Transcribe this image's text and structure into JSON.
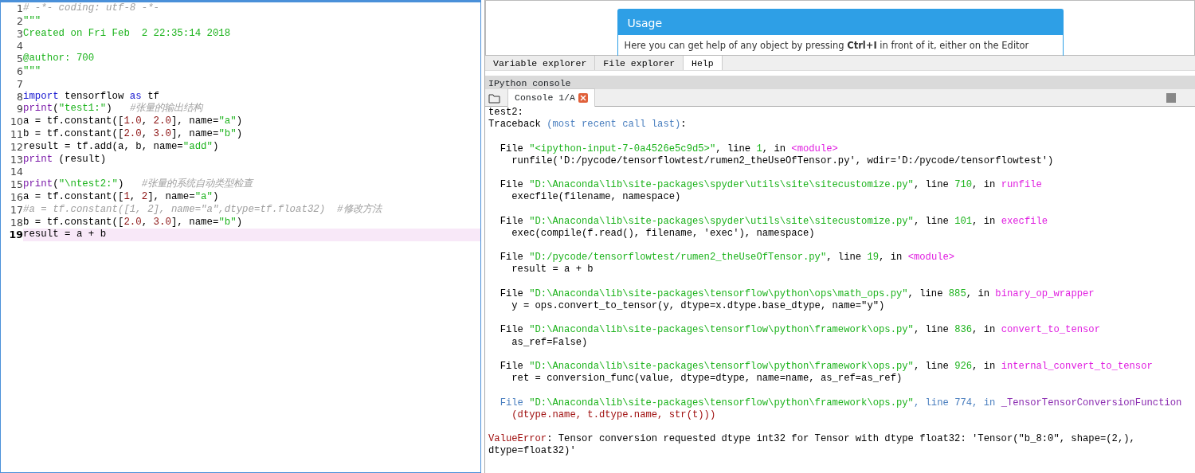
{
  "editor": {
    "lines": [
      {
        "number": "1",
        "current": false,
        "segments": [
          {
            "kind": "comment",
            "text": "# -*- coding: utf-8 -*-"
          }
        ]
      },
      {
        "number": "2",
        "current": false,
        "segments": [
          {
            "kind": "docstring",
            "text": "\"\"\""
          }
        ]
      },
      {
        "number": "3",
        "current": false,
        "segments": [
          {
            "kind": "docstring",
            "text": "Created on Fri Feb  2 22:35:14 2018"
          }
        ]
      },
      {
        "number": "4",
        "current": false
      },
      {
        "number": "5",
        "current": false,
        "segments": [
          {
            "kind": "docstring",
            "text": "@author: 700"
          }
        ]
      },
      {
        "number": "6",
        "current": false,
        "segments": [
          {
            "kind": "docstring",
            "text": "\"\"\""
          }
        ]
      },
      {
        "number": "7",
        "current": false
      },
      {
        "number": "8",
        "current": false,
        "segments": [
          {
            "kind": "keyword",
            "text": "import"
          },
          {
            "kind": "plain",
            "text": " tensorflow "
          },
          {
            "kind": "keyword",
            "text": "as"
          },
          {
            "kind": "plain",
            "text": " tf"
          }
        ]
      },
      {
        "number": "9",
        "current": false,
        "segments": [
          {
            "kind": "builtin",
            "text": "print"
          },
          {
            "kind": "plain",
            "text": "("
          },
          {
            "kind": "string",
            "text": "\"test1:\""
          },
          {
            "kind": "plain",
            "text": ")   "
          },
          {
            "kind": "comment",
            "text": "#张量的输出结构"
          }
        ]
      },
      {
        "number": "10",
        "current": false,
        "segments": [
          {
            "kind": "plain",
            "text": "a = tf.constant(["
          },
          {
            "kind": "number",
            "text": "1.0"
          },
          {
            "kind": "plain",
            "text": ", "
          },
          {
            "kind": "number",
            "text": "2.0"
          },
          {
            "kind": "plain",
            "text": "], name="
          },
          {
            "kind": "string",
            "text": "\"a\""
          },
          {
            "kind": "plain",
            "text": ")"
          }
        ]
      },
      {
        "number": "11",
        "current": false,
        "segments": [
          {
            "kind": "plain",
            "text": "b = tf.constant(["
          },
          {
            "kind": "number",
            "text": "2.0"
          },
          {
            "kind": "plain",
            "text": ", "
          },
          {
            "kind": "number",
            "text": "3.0"
          },
          {
            "kind": "plain",
            "text": "], name="
          },
          {
            "kind": "string",
            "text": "\"b\""
          },
          {
            "kind": "plain",
            "text": ")"
          }
        ]
      },
      {
        "number": "12",
        "current": false,
        "segments": [
          {
            "kind": "plain",
            "text": "result = tf.add(a, b, name="
          },
          {
            "kind": "string",
            "text": "\"add\""
          },
          {
            "kind": "plain",
            "text": ")"
          }
        ]
      },
      {
        "number": "13",
        "current": false,
        "segments": [
          {
            "kind": "builtin",
            "text": "print"
          },
          {
            "kind": "plain",
            "text": " (result)"
          }
        ]
      },
      {
        "number": "14",
        "current": false
      },
      {
        "number": "15",
        "current": false,
        "segments": [
          {
            "kind": "builtin",
            "text": "print"
          },
          {
            "kind": "plain",
            "text": "("
          },
          {
            "kind": "string",
            "text": "\"\\ntest2:\""
          },
          {
            "kind": "plain",
            "text": ")   "
          },
          {
            "kind": "comment",
            "text": "#张量的系统自动类型检查"
          }
        ]
      },
      {
        "number": "16",
        "current": false,
        "segments": [
          {
            "kind": "plain",
            "text": "a = tf.constant(["
          },
          {
            "kind": "number",
            "text": "1"
          },
          {
            "kind": "plain",
            "text": ", "
          },
          {
            "kind": "number",
            "text": "2"
          },
          {
            "kind": "plain",
            "text": "], name="
          },
          {
            "kind": "string",
            "text": "\"a\""
          },
          {
            "kind": "plain",
            "text": ")"
          }
        ]
      },
      {
        "number": "17",
        "current": false,
        "segments": [
          {
            "kind": "comment",
            "text": "#a = tf.constant([1, 2], name=\"a\",dtype=tf.float32)  #修改方法"
          }
        ]
      },
      {
        "number": "18",
        "current": false,
        "segments": [
          {
            "kind": "plain",
            "text": "b = tf.constant(["
          },
          {
            "kind": "number",
            "text": "2.0"
          },
          {
            "kind": "plain",
            "text": ", "
          },
          {
            "kind": "number",
            "text": "3.0"
          },
          {
            "kind": "plain",
            "text": "], name="
          },
          {
            "kind": "string",
            "text": "\"b\""
          },
          {
            "kind": "plain",
            "text": ")"
          }
        ]
      },
      {
        "number": "19",
        "current": true,
        "segments": [
          {
            "kind": "plain",
            "text": "result = a + b"
          }
        ]
      }
    ]
  },
  "help": {
    "card_title": "Usage",
    "card_text": "Here you can get help of any object by pressing **Ctrl+I** in front of it, either on the Editor"
  },
  "pane_tabs": [
    {
      "label": "Variable explorer",
      "selected": false
    },
    {
      "label": "File explorer",
      "selected": false
    },
    {
      "label": "Help",
      "selected": true
    }
  ],
  "console": {
    "pane_title": "IPython console",
    "tab_label": "Console 1/A",
    "blocks": [
      {
        "lines": [
          {
            "segments": [
              {
                "kind": "plain",
                "text": "test2:"
              }
            ]
          },
          {
            "segments": [
              {
                "kind": "plain",
                "text": "Traceback "
              },
              {
                "kind": "dim",
                "text": "(most recent call last)"
              },
              {
                "kind": "plain",
                "text": ":"
              }
            ]
          }
        ]
      },
      {
        "lines": [
          {
            "segments": [
              {
                "kind": "plain",
                "text": "  File "
              },
              {
                "kind": "path",
                "text": "\"<ipython-input-7-0a4526e5c9d5>\""
              },
              {
                "kind": "plain",
                "text": ", line "
              },
              {
                "kind": "path",
                "text": "1"
              },
              {
                "kind": "plain",
                "text": ", in "
              },
              {
                "kind": "func",
                "text": "<module>"
              }
            ]
          },
          {
            "segments": [
              {
                "kind": "plain",
                "text": "    runfile('D:/pycode/tensorflowtest/rumen2_theUseOfTensor.py', wdir='D:/pycode/tensorflowtest')"
              }
            ]
          }
        ]
      },
      {
        "lines": [
          {
            "segments": [
              {
                "kind": "plain",
                "text": "  File "
              },
              {
                "kind": "path",
                "text": "\"D:\\Anaconda\\lib\\site-packages\\spyder\\utils\\site\\sitecustomize.py\""
              },
              {
                "kind": "plain",
                "text": ", line "
              },
              {
                "kind": "path",
                "text": "710"
              },
              {
                "kind": "plain",
                "text": ", in "
              },
              {
                "kind": "func",
                "text": "runfile"
              }
            ]
          },
          {
            "segments": [
              {
                "kind": "plain",
                "text": "    execfile(filename, namespace)"
              }
            ]
          }
        ]
      },
      {
        "lines": [
          {
            "segments": [
              {
                "kind": "plain",
                "text": "  File "
              },
              {
                "kind": "path",
                "text": "\"D:\\Anaconda\\lib\\site-packages\\spyder\\utils\\site\\sitecustomize.py\""
              },
              {
                "kind": "plain",
                "text": ", line "
              },
              {
                "kind": "path",
                "text": "101"
              },
              {
                "kind": "plain",
                "text": ", in "
              },
              {
                "kind": "func",
                "text": "execfile"
              }
            ]
          },
          {
            "segments": [
              {
                "kind": "plain",
                "text": "    exec(compile(f.read(), filename, 'exec'), namespace)"
              }
            ]
          }
        ]
      },
      {
        "lines": [
          {
            "segments": [
              {
                "kind": "plain",
                "text": "  File "
              },
              {
                "kind": "path",
                "text": "\"D:/pycode/tensorflowtest/rumen2_theUseOfTensor.py\""
              },
              {
                "kind": "plain",
                "text": ", line "
              },
              {
                "kind": "path",
                "text": "19"
              },
              {
                "kind": "plain",
                "text": ", in "
              },
              {
                "kind": "func",
                "text": "<module>"
              }
            ]
          },
          {
            "segments": [
              {
                "kind": "plain",
                "text": "    result = a + b"
              }
            ]
          }
        ]
      },
      {
        "lines": [
          {
            "segments": [
              {
                "kind": "plain",
                "text": "  File "
              },
              {
                "kind": "path",
                "text": "\"D:\\Anaconda\\lib\\site-packages\\tensorflow\\python\\ops\\math_ops.py\""
              },
              {
                "kind": "plain",
                "text": ", line "
              },
              {
                "kind": "path",
                "text": "885"
              },
              {
                "kind": "plain",
                "text": ", in "
              },
              {
                "kind": "func",
                "text": "binary_op_wrapper"
              }
            ]
          },
          {
            "segments": [
              {
                "kind": "plain",
                "text": "    y = ops.convert_to_tensor(y, dtype=x.dtype.base_dtype, name=\"y\")"
              }
            ]
          }
        ]
      },
      {
        "lines": [
          {
            "segments": [
              {
                "kind": "plain",
                "text": "  File "
              },
              {
                "kind": "path",
                "text": "\"D:\\Anaconda\\lib\\site-packages\\tensorflow\\python\\framework\\ops.py\""
              },
              {
                "kind": "plain",
                "text": ", line "
              },
              {
                "kind": "path",
                "text": "836"
              },
              {
                "kind": "plain",
                "text": ", in "
              },
              {
                "kind": "func",
                "text": "convert_to_tensor"
              }
            ]
          },
          {
            "segments": [
              {
                "kind": "plain",
                "text": "    as_ref=False)"
              }
            ]
          }
        ]
      },
      {
        "lines": [
          {
            "segments": [
              {
                "kind": "plain",
                "text": "  File "
              },
              {
                "kind": "path",
                "text": "\"D:\\Anaconda\\lib\\site-packages\\tensorflow\\python\\framework\\ops.py\""
              },
              {
                "kind": "plain",
                "text": ", line "
              },
              {
                "kind": "path",
                "text": "926"
              },
              {
                "kind": "plain",
                "text": ", in "
              },
              {
                "kind": "func",
                "text": "internal_convert_to_tensor"
              }
            ]
          },
          {
            "segments": [
              {
                "kind": "plain",
                "text": "    ret = conversion_func(value, dtype=dtype, name=name, as_ref=as_ref)"
              }
            ]
          }
        ]
      },
      {
        "lines": [
          {
            "segments": [
              {
                "kind": "dim",
                "text": "  File "
              },
              {
                "kind": "path",
                "text": "\"D:\\Anaconda\\lib\\site-packages\\tensorflow\\python\\framework\\ops.py\""
              },
              {
                "kind": "dim",
                "text": ", line "
              },
              {
                "kind": "dim",
                "text": "774"
              },
              {
                "kind": "dim",
                "text": ", in "
              },
              {
                "kind": "funcdark",
                "text": "_TensorTensorConversionFunction"
              }
            ]
          },
          {
            "segments": [
              {
                "kind": "error",
                "text": "    (dtype.name, t.dtype.name, str(t)))"
              }
            ]
          }
        ]
      },
      {
        "lines": [
          {
            "segments": [
              {
                "kind": "error",
                "text": "ValueError"
              },
              {
                "kind": "plain",
                "text": ": Tensor conversion requested dtype int32 for Tensor with dtype float32: 'Tensor(\"b_8:0\", shape=(2,),"
              }
            ]
          },
          {
            "segments": [
              {
                "kind": "plain",
                "text": "dtype=float32)'"
              }
            ]
          }
        ]
      }
    ]
  }
}
